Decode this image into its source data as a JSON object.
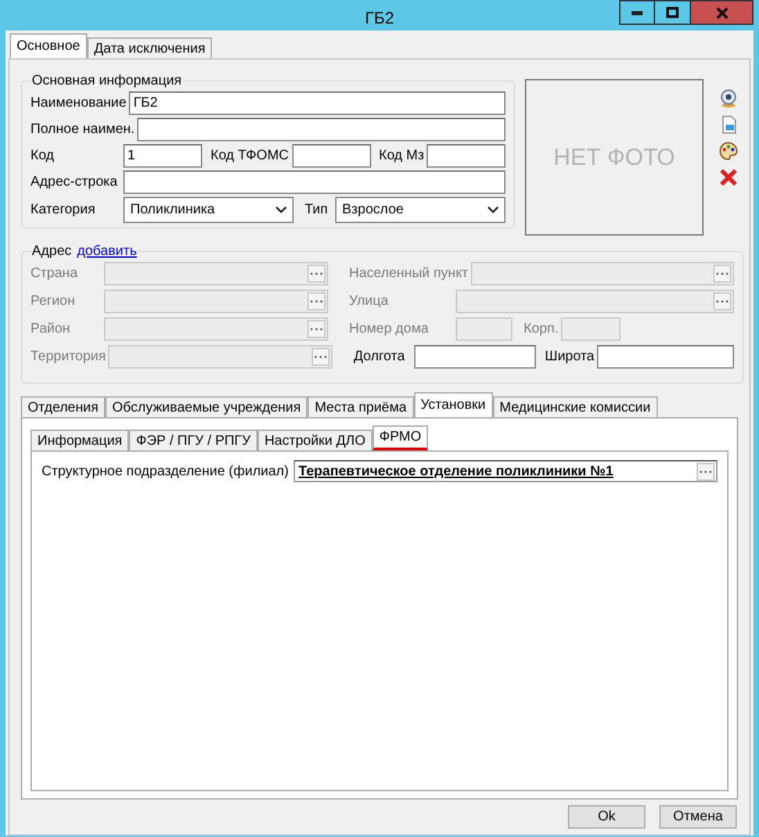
{
  "window": {
    "title": "ГБ2"
  },
  "tabs": [
    {
      "label": "Основное",
      "selected": true
    },
    {
      "label": "Дата исключения",
      "selected": false
    }
  ],
  "main_info": {
    "title": "Основная информация",
    "name": {
      "label": "Наименование",
      "value": "ГБ2"
    },
    "full_name": {
      "label": "Полное наимен."
    },
    "code": {
      "label": "Код",
      "value": "1"
    },
    "tfoms": {
      "label": "Код ТФОМС"
    },
    "mz": {
      "label": "Код Мз"
    },
    "address_line": {
      "label": "Адрес-строка"
    },
    "category": {
      "label": "Категория",
      "value": "Поликлиника"
    },
    "type": {
      "label": "Тип",
      "value": "Взрослое"
    }
  },
  "photo": {
    "text": "НЕТ ФОТО"
  },
  "address": {
    "title": "Адрес",
    "link": "добавить",
    "rows": [
      {
        "left": {
          "label": "Страна",
          "disabled": true
        },
        "right": [
          {
            "label": "Населенный пункт",
            "disabled": true
          }
        ]
      },
      {
        "left": {
          "label": "Регион",
          "disabled": true
        },
        "right": [
          {
            "label": "Улица",
            "disabled": true
          }
        ]
      },
      {
        "left": {
          "label": "Район",
          "disabled": true
        },
        "right": [
          {
            "label": "Номер дома",
            "disabled": true
          },
          {
            "label": "Корп.",
            "disabled": true
          }
        ]
      },
      {
        "left": {
          "label": "Территория",
          "disabled": true
        },
        "right": [
          {
            "label": "Долгота",
            "disabled": false
          },
          {
            "label": "Широта",
            "disabled": false
          }
        ]
      }
    ]
  },
  "lower_tabs": [
    {
      "label": "Отделения",
      "selected": false
    },
    {
      "label": "Обслуживаемые учреждения",
      "selected": false
    },
    {
      "label": "Места приёма",
      "selected": false
    },
    {
      "label": "Установки",
      "selected": true
    },
    {
      "label": "Медицинские комиссии",
      "selected": false
    }
  ],
  "inner_tabs": [
    {
      "label": "Информация",
      "selected": false
    },
    {
      "label": "ФЭР / ПГУ / РПГУ",
      "selected": false
    },
    {
      "label": "Настройки ДЛО",
      "selected": false
    },
    {
      "label": "ФРМО",
      "selected": true
    }
  ],
  "fmro": {
    "label": "Структурное подразделение (филиал)",
    "value": "Терапевтическое отделение поликлиники №1"
  },
  "buttons": [
    "Ok",
    "Отмена"
  ]
}
